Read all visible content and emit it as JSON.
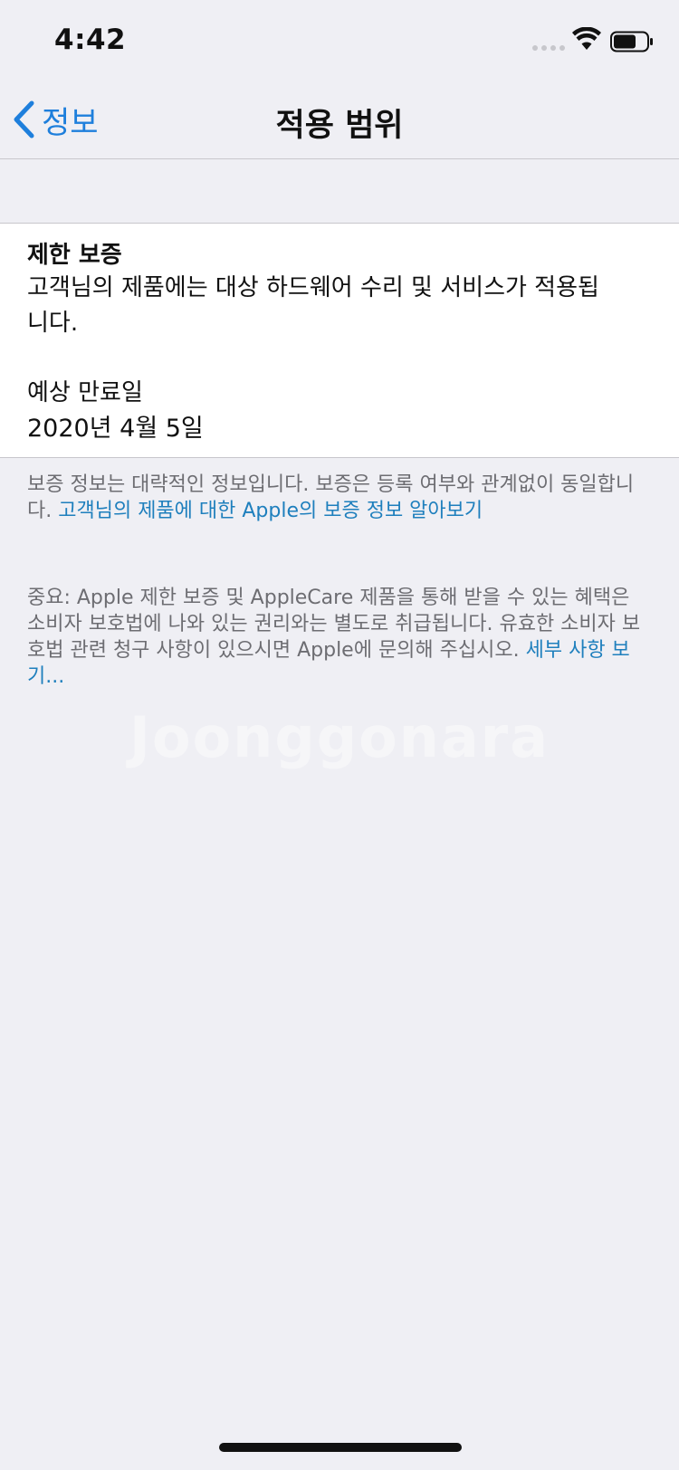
{
  "status_bar": {
    "time": "4:42"
  },
  "nav": {
    "back_label": "정보",
    "title": "적용 범위"
  },
  "warranty_card": {
    "title": "제한 보증",
    "description": "고객님의 제품에는 대상 하드웨어 수리 및 서비스가 적용됩니다.",
    "expiry_label": "예상 만료일",
    "expiry_date": "2020년 4월 5일"
  },
  "footer1": {
    "text": "보증 정보는 대략적인 정보입니다. 보증은 등록 여부와 관계없이 동일합니다. ",
    "link": "고객님의 제품에 대한 Apple의 보증 정보 알아보기"
  },
  "footer2": {
    "text": "중요: Apple 제한 보증 및 AppleCare 제품을 통해 받을 수 있는 혜택은 소비자 보호법에 나와 있는 권리와는 별도로 취급됩니다. 유효한 소비자 보호법 관련 청구 사항이 있으시면 Apple에 문의해 주십시오. ",
    "link": "세부 사항 보기..."
  },
  "watermark": "Joonggonara",
  "colors": {
    "accent": "#1e7fdc",
    "link": "#1e7fbd",
    "background": "#efeff4",
    "secondary_text": "#6d6d72"
  }
}
